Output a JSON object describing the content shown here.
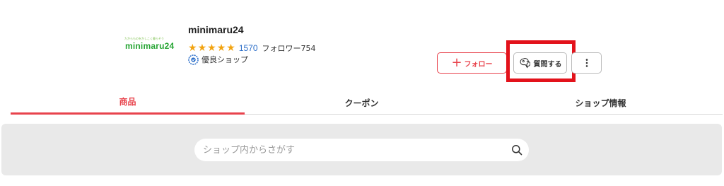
{
  "shop": {
    "logo_tagline": "たからものをかしこく暮らそう",
    "logo_text": "minimaru24",
    "name": "minimaru24",
    "rating_count": "1570",
    "followers": "フォロワー754",
    "badge": "優良ショップ",
    "stars": 5
  },
  "actions": {
    "follow_label": "フォロー",
    "ask_label": "質問する",
    "more_icon": "kebab-menu-icon"
  },
  "tabs": [
    {
      "label": "商品",
      "active": true
    },
    {
      "label": "クーポン",
      "active": false
    },
    {
      "label": "ショップ情報",
      "active": false
    }
  ],
  "search": {
    "placeholder": "ショップ内からさがす"
  },
  "colors": {
    "accent": "#e8434c",
    "star": "#f2a30f",
    "link": "#2d6fc9",
    "highlight": "#e3121b",
    "logo_green": "#27a534"
  }
}
